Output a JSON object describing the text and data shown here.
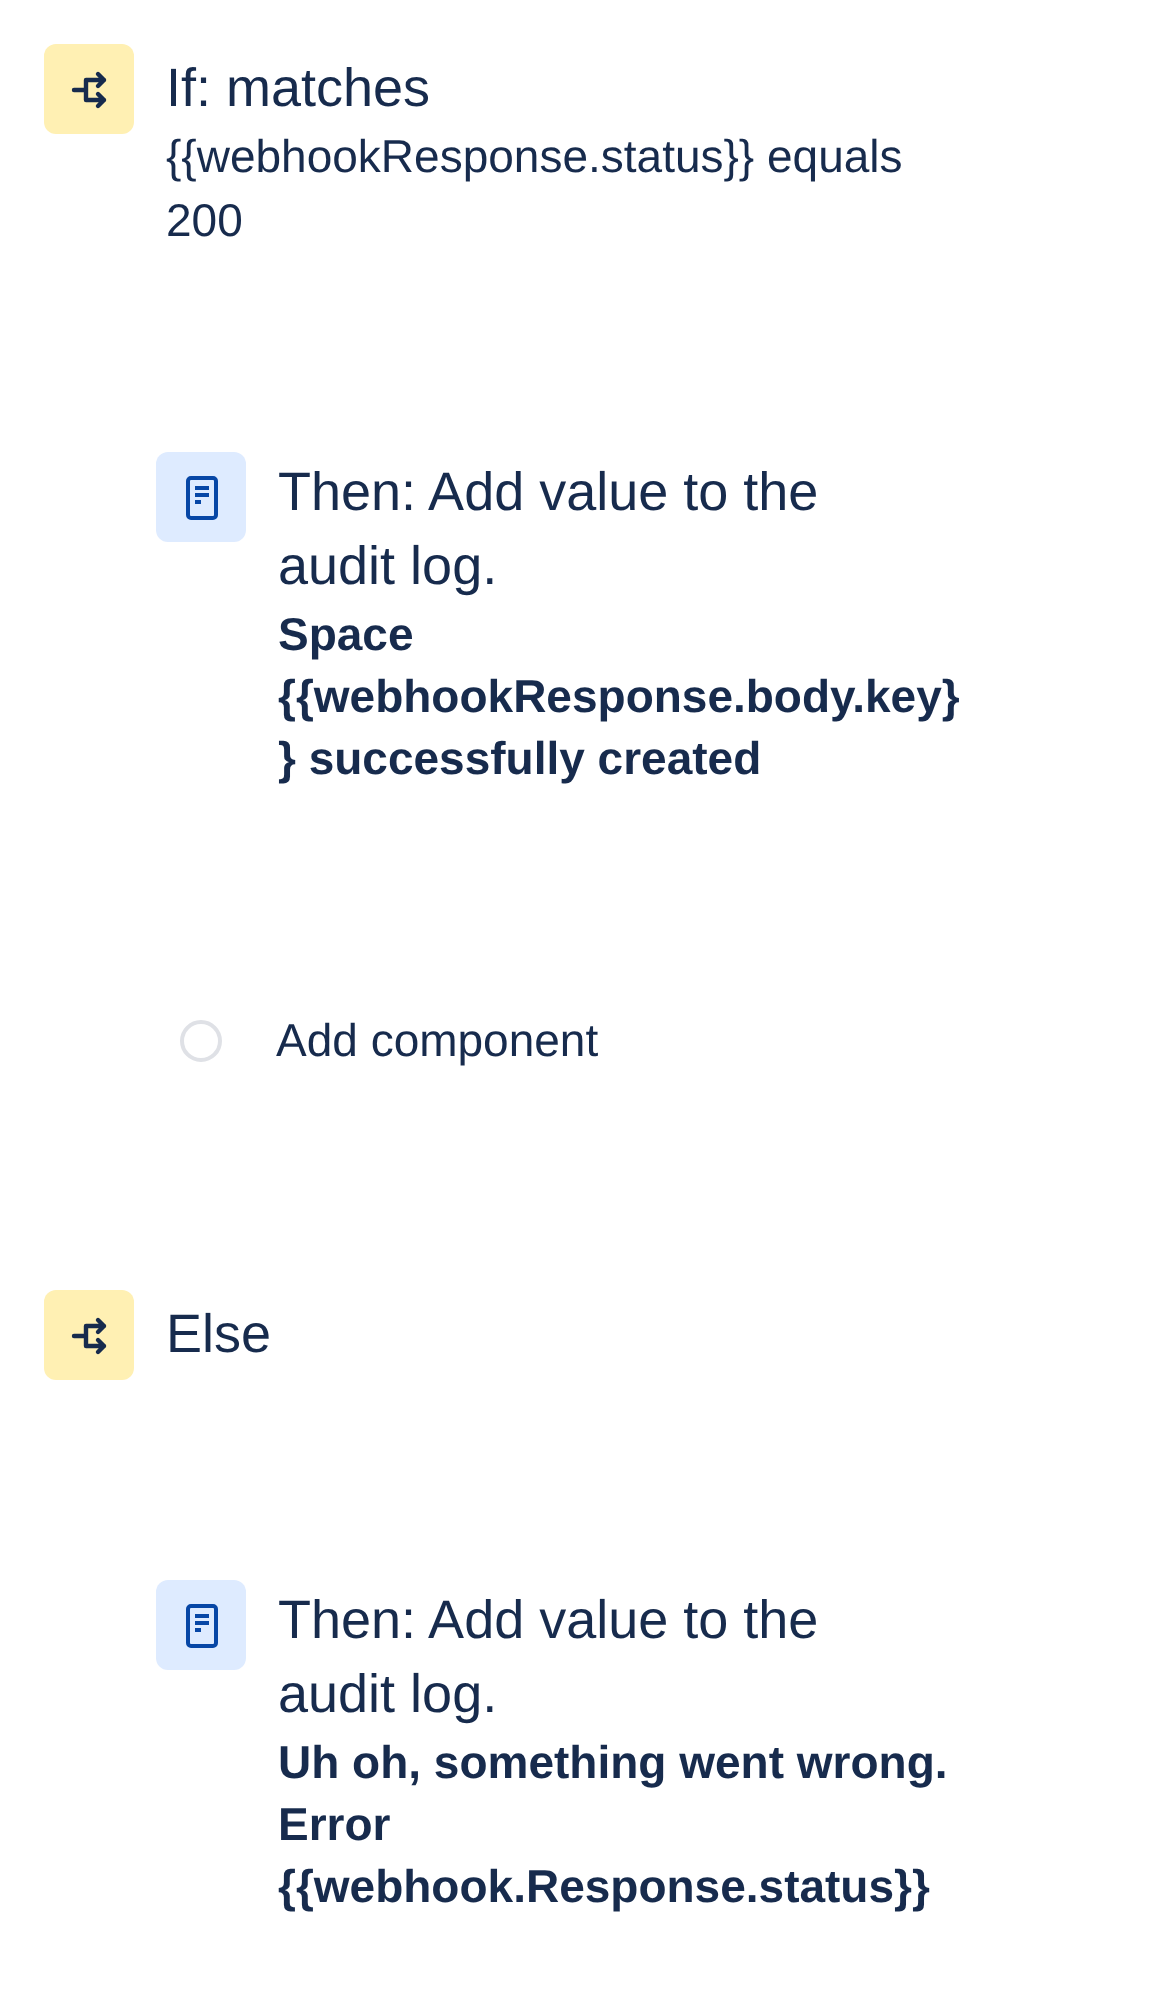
{
  "items": [
    {
      "kind": "condition",
      "title_lines": [
        "If: matches"
      ],
      "detail_lines": [
        "{{webhookResponse.status}} equals",
        "200"
      ]
    },
    {
      "kind": "action",
      "title_lines": [
        "Then: Add value to the",
        "audit log."
      ],
      "detail_lines": [
        "Space",
        "{{webhookResponse.body.key}",
        "} successfully created"
      ]
    },
    {
      "kind": "add",
      "title_lines": [
        "Add component"
      ]
    },
    {
      "kind": "condition",
      "title_lines": [
        "Else"
      ]
    },
    {
      "kind": "action",
      "title_lines": [
        "Then: Add value to the",
        "audit log."
      ],
      "detail_lines": [
        "Uh oh, something went wrong.",
        "Error",
        "{{webhook.Response.status}}"
      ]
    }
  ]
}
